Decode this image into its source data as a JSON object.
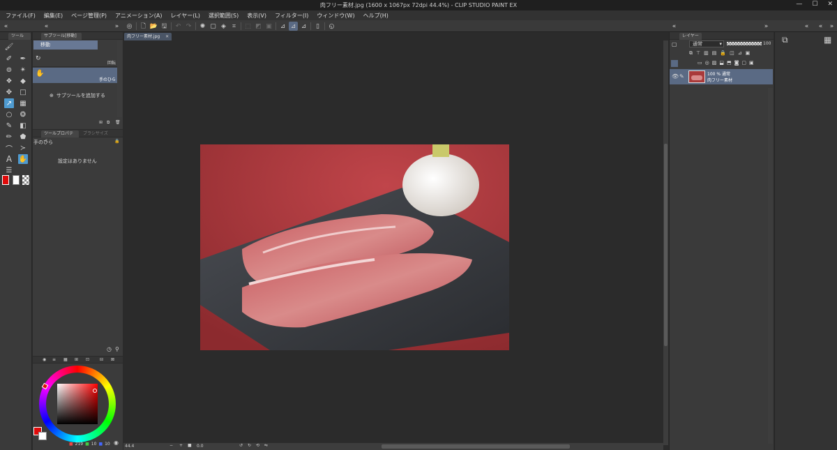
{
  "window": {
    "title": "肉フリー素材.jpg (1600 x 1067px 72dpi 44.4%) - CLIP STUDIO PAINT EX"
  },
  "menu": [
    "ファイル(F)",
    "編集(E)",
    "ページ管理(P)",
    "アニメーション(A)",
    "レイヤー(L)",
    "選択範囲(S)",
    "表示(V)",
    "フィルター(I)",
    "ウィンドウ(W)",
    "ヘルプ(H)"
  ],
  "tool_panel": {
    "tab_label": "ツール"
  },
  "subtool_panel": {
    "tab_label": "サブツール[移動]",
    "group_name": "移動",
    "items": [
      {
        "label": "回転"
      },
      {
        "label": "手のひら",
        "selected": true
      }
    ],
    "add_button": "サブツールを追加する"
  },
  "tool_property": {
    "tab_label": "ツールプロパティ",
    "tab2_label": "ブラシサイズ",
    "subtool_name": "手のひら",
    "empty_message": "設定はありません"
  },
  "color_panel": {
    "r": "219",
    "g": "10",
    "b": "10",
    "main_color": "#e00b0b",
    "sub_color": "#ffffff"
  },
  "canvas": {
    "document_tab": "肉フリー素材.jpg",
    "zoom": "44.4",
    "rotation": "0.0"
  },
  "layer_panel": {
    "tab_label": "レイヤー",
    "blend_mode": "通常",
    "opacity": "100",
    "layers": [
      {
        "opacity_mode": "100 % 通常",
        "name": "肉フリー素材"
      }
    ]
  },
  "colors": {
    "accent": "#4f9bd0",
    "selection": "#5a6a84"
  }
}
